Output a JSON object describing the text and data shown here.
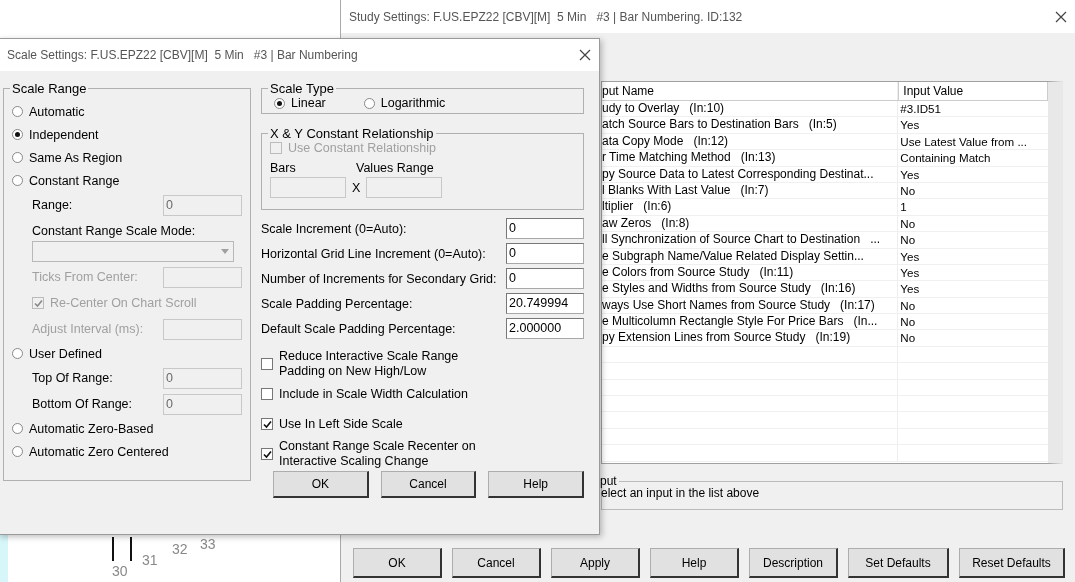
{
  "chart": {
    "bar_numbers": [
      "30",
      "31",
      "32",
      "33"
    ]
  },
  "study_settings": {
    "title": "Study Settings: F.US.EPZ22 [CBV][M]  5 Min   #3 | Bar Numbering. ID:132",
    "columns": [
      "put Name",
      "Input Value"
    ],
    "rows": [
      {
        "name": "udy to Overlay   (In:10)",
        "value": "#3.ID51"
      },
      {
        "name": "atch Source Bars to Destination Bars   (In:5)",
        "value": "Yes"
      },
      {
        "name": "ata Copy Mode   (In:12)",
        "value": "Use Latest Value from ..."
      },
      {
        "name": "r Time Matching Method   (In:13)",
        "value": "Containing Match"
      },
      {
        "name": "py Source Data to Latest Corresponding Destinat...",
        "value": "Yes"
      },
      {
        "name": "l Blanks With Last Value   (In:7)",
        "value": "No"
      },
      {
        "name": "ltiplier   (In:6)",
        "value": "1"
      },
      {
        "name": "aw Zeros   (In:8)",
        "value": "No"
      },
      {
        "name": "ll Synchronization of Source Chart to Destination   ...",
        "value": "No"
      },
      {
        "name": "e Subgraph Name/Value Related Display Settin...",
        "value": "Yes"
      },
      {
        "name": "e Colors from Source Study   (In:11)",
        "value": "Yes"
      },
      {
        "name": "e Styles and Widths from Source Study   (In:16)",
        "value": "Yes"
      },
      {
        "name": "ways Use Short Names from Source Study   (In:17)",
        "value": "No"
      },
      {
        "name": "e Multicolumn Rectangle Style For Price Bars   (In...",
        "value": "No"
      },
      {
        "name": "py Extension Lines from Source Study   (In:19)",
        "value": "No"
      }
    ],
    "input_group": {
      "title": "put",
      "text": "elect an input in the list above"
    },
    "buttons": [
      "OK",
      "Cancel",
      "Apply",
      "Help",
      "Description",
      "Set Defaults",
      "Reset Defaults"
    ]
  },
  "scale_settings": {
    "title": "Scale Settings: F.US.EPZ22 [CBV][M]  5 Min   #3 | Bar Numbering",
    "scale_range": {
      "title": "Scale Range",
      "items": [
        {
          "kind": "radio",
          "label": "Automatic",
          "selected": false
        },
        {
          "kind": "radio",
          "label": "Independent",
          "selected": true
        },
        {
          "kind": "radio",
          "label": "Same As Region",
          "selected": false
        },
        {
          "kind": "radio",
          "label": "Constant Range",
          "selected": false
        },
        {
          "kind": "field",
          "label": "Range:",
          "value": "0",
          "disabled": false,
          "editable": false
        },
        {
          "kind": "label",
          "label": "Constant Range Scale Mode:"
        },
        {
          "kind": "dropdown",
          "disabled": true
        },
        {
          "kind": "field",
          "label": "Ticks From Center:",
          "disabled": true,
          "editable": false
        },
        {
          "kind": "checkbox",
          "label": "Re-Center On Chart Scroll",
          "checked": true,
          "disabled": true
        },
        {
          "kind": "field",
          "label": "Adjust Interval (ms):",
          "disabled": true,
          "editable": false
        },
        {
          "kind": "radio",
          "label": "User Defined",
          "selected": false
        },
        {
          "kind": "field",
          "label": "Top Of Range:",
          "value": "0",
          "disabled": false,
          "editable": false
        },
        {
          "kind": "field",
          "label": "Bottom Of Range:",
          "value": "0",
          "disabled": false,
          "editable": false
        },
        {
          "kind": "radio",
          "label": "Automatic Zero-Based",
          "selected": false
        },
        {
          "kind": "radio",
          "label": "Automatic Zero Centered",
          "selected": false
        }
      ]
    },
    "scale_type": {
      "title": "Scale Type",
      "options": [
        {
          "label": "Linear",
          "selected": true
        },
        {
          "label": "Logarithmic",
          "selected": false
        }
      ]
    },
    "xy_relationship": {
      "title": "X & Y Constant Relationship",
      "checkbox": {
        "label": "Use Constant Relationship",
        "checked": false,
        "disabled": true
      },
      "bars_label": "Bars",
      "times": "X",
      "values_label": "Values Range"
    },
    "fields": [
      {
        "label": "Scale Increment (0=Auto):",
        "value": "0"
      },
      {
        "label": "Horizontal Grid Line Increment (0=Auto):",
        "value": "0"
      },
      {
        "label": "Number of Increments for Secondary Grid:",
        "value": "0"
      },
      {
        "label": "Scale Padding Percentage:",
        "value": "20.749994"
      },
      {
        "label": "Default Scale Padding Percentage:",
        "value": "2.000000"
      }
    ],
    "checkboxes": [
      {
        "label": "Reduce Interactive Scale Range Padding on New High/Low",
        "checked": false
      },
      {
        "label": "Include in Scale Width Calculation",
        "checked": false
      },
      {
        "label": "Use In Left Side Scale",
        "checked": true
      },
      {
        "label": "Constant Range Scale Recenter on Interactive Scaling Change",
        "checked": true
      }
    ],
    "buttons": [
      "OK",
      "Cancel",
      "Help"
    ]
  }
}
